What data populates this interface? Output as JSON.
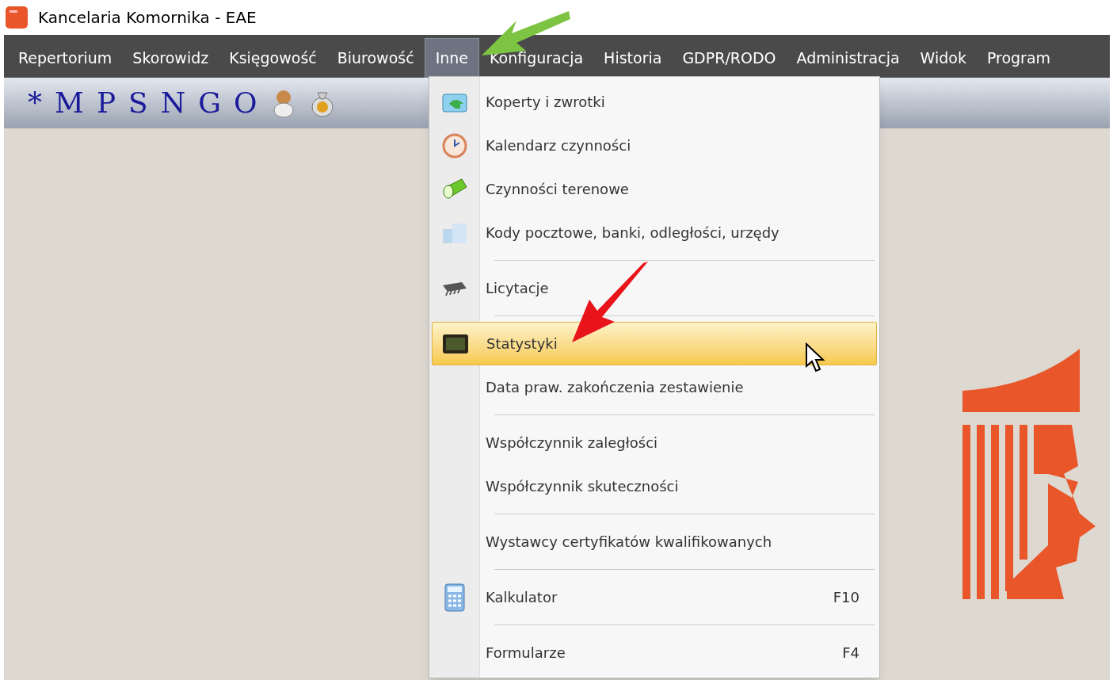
{
  "window": {
    "title": "Kancelaria Komornika - EAE"
  },
  "menu_bar": [
    {
      "label": "Repertorium",
      "selected": false
    },
    {
      "label": "Skorowidz",
      "selected": false
    },
    {
      "label": "Księgowość",
      "selected": false
    },
    {
      "label": "Biurowość",
      "selected": false
    },
    {
      "label": "Inne",
      "selected": true
    },
    {
      "label": "Konfiguracja",
      "selected": false
    },
    {
      "label": "Historia",
      "selected": false
    },
    {
      "label": "GDPR/RODO",
      "selected": false
    },
    {
      "label": "Administracja",
      "selected": false
    },
    {
      "label": "Widok",
      "selected": false
    },
    {
      "label": "Program",
      "selected": false
    }
  ],
  "toolbar": [
    "*",
    "M",
    "P",
    "S",
    "N",
    "G",
    "O"
  ],
  "dropdown": [
    {
      "kind": "item",
      "label": "Koperty i zwrotki",
      "selected": false
    },
    {
      "kind": "item",
      "label": "Kalendarz czynności",
      "selected": false
    },
    {
      "kind": "item",
      "label": "Czynności terenowe",
      "selected": false
    },
    {
      "kind": "item",
      "label": "Kody pocztowe, banki, odległości, urzędy",
      "selected": false
    },
    {
      "kind": "separator"
    },
    {
      "kind": "item",
      "label": "Licytacje",
      "selected": false
    },
    {
      "kind": "separator"
    },
    {
      "kind": "item",
      "label": "Statystyki",
      "selected": true
    },
    {
      "kind": "item",
      "label": "Data praw. zakończenia zestawienie",
      "selected": false
    },
    {
      "kind": "separator"
    },
    {
      "kind": "item",
      "label": "Współczynnik zaległości",
      "selected": false
    },
    {
      "kind": "item",
      "label": "Współczynnik skuteczności",
      "selected": false
    },
    {
      "kind": "separator"
    },
    {
      "kind": "item",
      "label": "Wystawcy certyfikatów kwalifikowanych",
      "selected": false
    },
    {
      "kind": "separator"
    },
    {
      "kind": "item",
      "label": "Kalkulator",
      "shortcut": "F10",
      "selected": false
    },
    {
      "kind": "separator"
    },
    {
      "kind": "item",
      "label": "Formularze",
      "shortcut": "F4",
      "selected": false
    }
  ]
}
